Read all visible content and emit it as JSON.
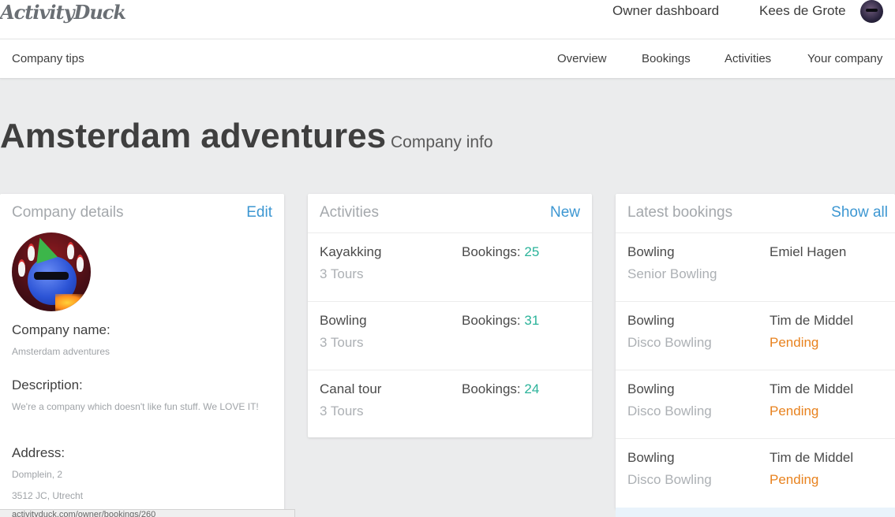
{
  "topbar": {
    "logo": "ActivityDuck",
    "owner_dashboard": "Owner dashboard",
    "user_name": "Kees de Grote"
  },
  "subnav": {
    "left": "Company tips",
    "items": [
      "Overview",
      "Bookings",
      "Activities",
      "Your company"
    ]
  },
  "page": {
    "title": "Amsterdam adventures",
    "subtitle": "Company info"
  },
  "company_details": {
    "title": "Company details",
    "action": "Edit",
    "name_label": "Company name:",
    "name_value": "Amsterdam adventures",
    "description_label": "Description:",
    "description_value": "We're a company which doesn't like fun stuff. We LOVE IT!",
    "address_label": "Address:",
    "address_line1": "Domplein, 2",
    "address_line2": "3512 JC, Utrecht"
  },
  "activities": {
    "title": "Activities",
    "action": "New",
    "bookings_label": "Bookings:",
    "items": [
      {
        "name": "Kayakking",
        "tours": "3 Tours",
        "bookings": "25"
      },
      {
        "name": "Bowling",
        "tours": "3 Tours",
        "bookings": "31"
      },
      {
        "name": "Canal tour",
        "tours": "3 Tours",
        "bookings": "24"
      }
    ]
  },
  "latest_bookings": {
    "title": "Latest bookings",
    "action": "Show all",
    "items": [
      {
        "activity": "Bowling",
        "tour": "Senior Bowling",
        "customer": "Emiel Hagen",
        "status": ""
      },
      {
        "activity": "Bowling",
        "tour": "Disco Bowling",
        "customer": "Tim de Middel",
        "status": "Pending"
      },
      {
        "activity": "Bowling",
        "tour": "Disco Bowling",
        "customer": "Tim de Middel",
        "status": "Pending"
      },
      {
        "activity": "Bowling",
        "tour": "Disco Bowling",
        "customer": "Tim de Middel",
        "status": "Pending"
      }
    ]
  },
  "statusbar": {
    "url": "activityduck.com/owner/bookings/260"
  },
  "colors": {
    "accent_link": "#3d97d2",
    "count_green": "#2bb39a",
    "pending_orange": "#e8821e",
    "background": "#ebeced"
  }
}
